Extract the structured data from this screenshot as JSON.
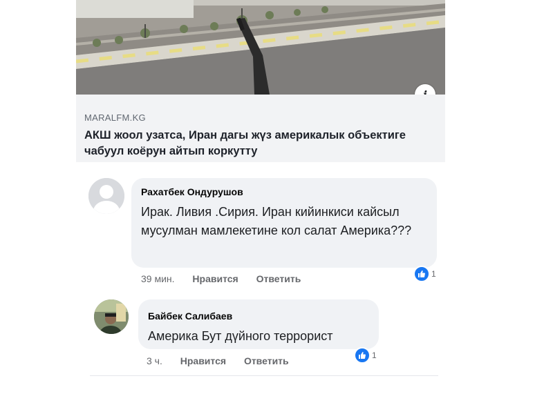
{
  "post": {
    "image_alt": "street-with-rifle-photo",
    "info_label": "i",
    "link": {
      "domain": "MARALFM.KG",
      "title": "АКШ жоол узатса, Иран дагы жүз америкалык объектиге чабуул коёрун айтып коркутту"
    }
  },
  "comments": [
    {
      "author": "Рахатбек Ондурушов",
      "text": "Ирак. Ливия .Сирия. Иран кийинкиси кайсыл мусулман мамлекетине кол салат Америка???",
      "time": "39 мин.",
      "like_label": "Нравится",
      "reply_label": "Ответить",
      "reaction_icon": "thumbs-up-icon",
      "reaction_count": "1"
    },
    {
      "author": "Байбек Салибаев",
      "text": "Америка Бут дүйного террорист",
      "time": "3 ч.",
      "like_label": "Нравится",
      "reply_label": "Ответить",
      "reaction_icon": "thumbs-up-icon",
      "reaction_count": "1"
    }
  ],
  "colors": {
    "link_preview_bg": "#f2f3f5",
    "bubble_bg": "#f0f2f5",
    "like_blue": "#1877f2"
  }
}
